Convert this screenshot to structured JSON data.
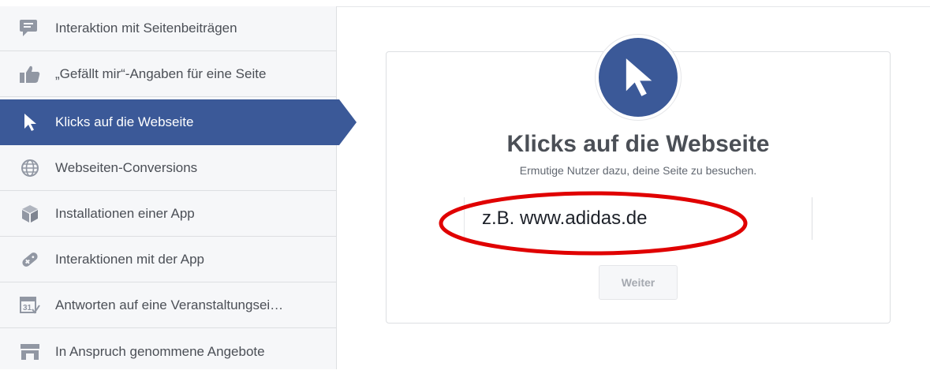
{
  "sidebar": {
    "items": [
      {
        "label": "Interaktion mit Seitenbeiträgen",
        "icon": "comment-icon"
      },
      {
        "label": "„Gefällt mir“-Angaben für eine Seite",
        "icon": "thumbs-up-icon"
      },
      {
        "label": "Klicks auf die Webseite",
        "icon": "cursor-icon",
        "active": true
      },
      {
        "label": "Webseiten-Conversions",
        "icon": "globe-icon"
      },
      {
        "label": "Installationen einer App",
        "icon": "cube-icon"
      },
      {
        "label": "Interaktionen mit der App",
        "icon": "gamepad-icon"
      },
      {
        "label": "Antworten auf eine Veranstaltungsei…",
        "icon": "calendar-icon"
      },
      {
        "label": "In Anspruch genommene Angebote",
        "icon": "store-icon"
      }
    ]
  },
  "main": {
    "title": "Klicks auf die Webseite",
    "subtitle": "Ermutige Nutzer dazu, deine Seite zu besuchen.",
    "url_input": {
      "placeholder": "z.B. www.adidas.de"
    },
    "weiter_label": "Weiter",
    "icon": "cursor-icon"
  },
  "colors": {
    "accent": "#3b5998",
    "annotation": "#e00000",
    "sidebar_bg": "#f6f7f9"
  }
}
